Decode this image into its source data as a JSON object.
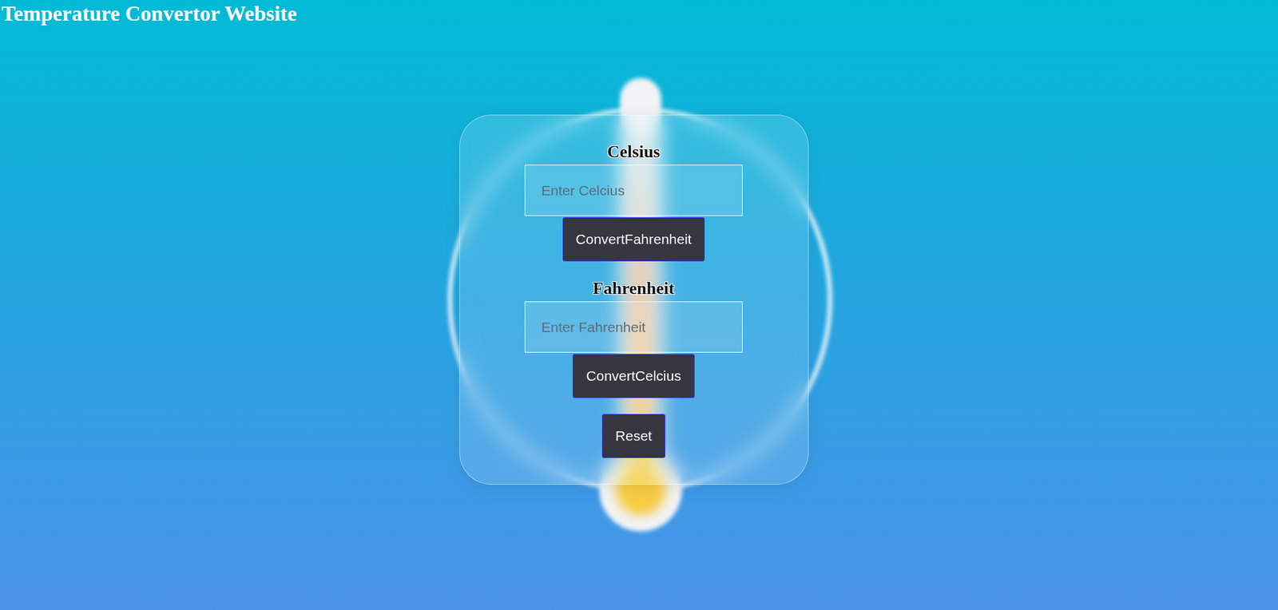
{
  "title": "Temperature Convertor Website",
  "converters": [
    {
      "heading": "Celsius",
      "placeholder": "Enter Celcius",
      "button": "ConvertFahrenheit"
    },
    {
      "heading": "Fahrenheit",
      "placeholder": "Enter Fahrenheit",
      "button": "ConvertCelcius"
    }
  ],
  "reset": "Reset"
}
